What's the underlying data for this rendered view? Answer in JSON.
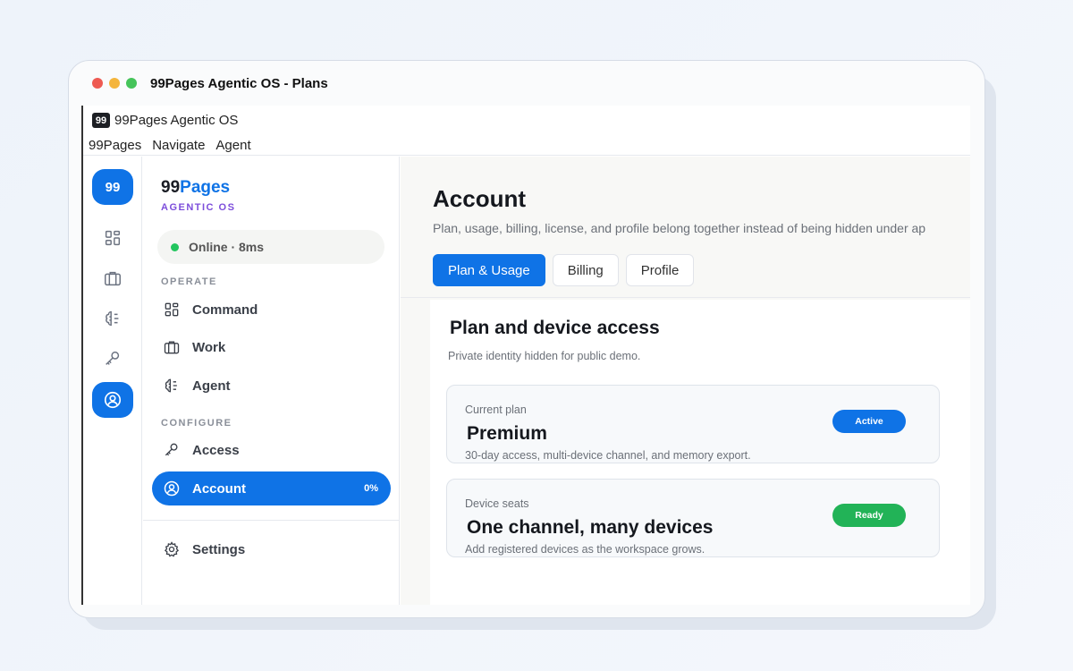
{
  "window": {
    "title": "99Pages Agentic OS - Plans"
  },
  "app": {
    "logo": "99",
    "name": "99Pages Agentic OS",
    "menu": [
      "99Pages",
      "Navigate",
      "Agent"
    ]
  },
  "rail": {
    "home_label": "99"
  },
  "sidebar": {
    "brand_prefix": "99",
    "brand_accent": "Pages",
    "brand_sub": "AGENTIC OS",
    "status": "Online · 8ms",
    "operate_label": "OPERATE",
    "configure_label": "CONFIGURE",
    "items": {
      "command": "Command",
      "work": "Work",
      "agent": "Agent",
      "access": "Access",
      "account": "Account",
      "account_count": "0%",
      "settings": "Settings"
    }
  },
  "main": {
    "title": "Account",
    "description": "Plan, usage, billing, license, and profile belong together instead of being hidden under ap",
    "tabs": [
      "Plan & Usage",
      "Billing",
      "Profile"
    ],
    "section_title": "Plan and device access",
    "section_desc": "Private identity hidden for public demo.",
    "cards": [
      {
        "label": "Current plan",
        "value": "Premium",
        "note": "30-day access, multi-device channel, and memory export.",
        "badge": "Active",
        "badge_color": "#0f73e6"
      },
      {
        "label": "Device seats",
        "value": "One channel, many devices",
        "note": "Add registered devices as the workspace grows.",
        "badge": "Ready",
        "badge_color": "#22b357"
      }
    ]
  },
  "colors": {
    "accent": "#0f73e6",
    "brand_sub": "#7c4ddb",
    "online": "#22c55e"
  }
}
